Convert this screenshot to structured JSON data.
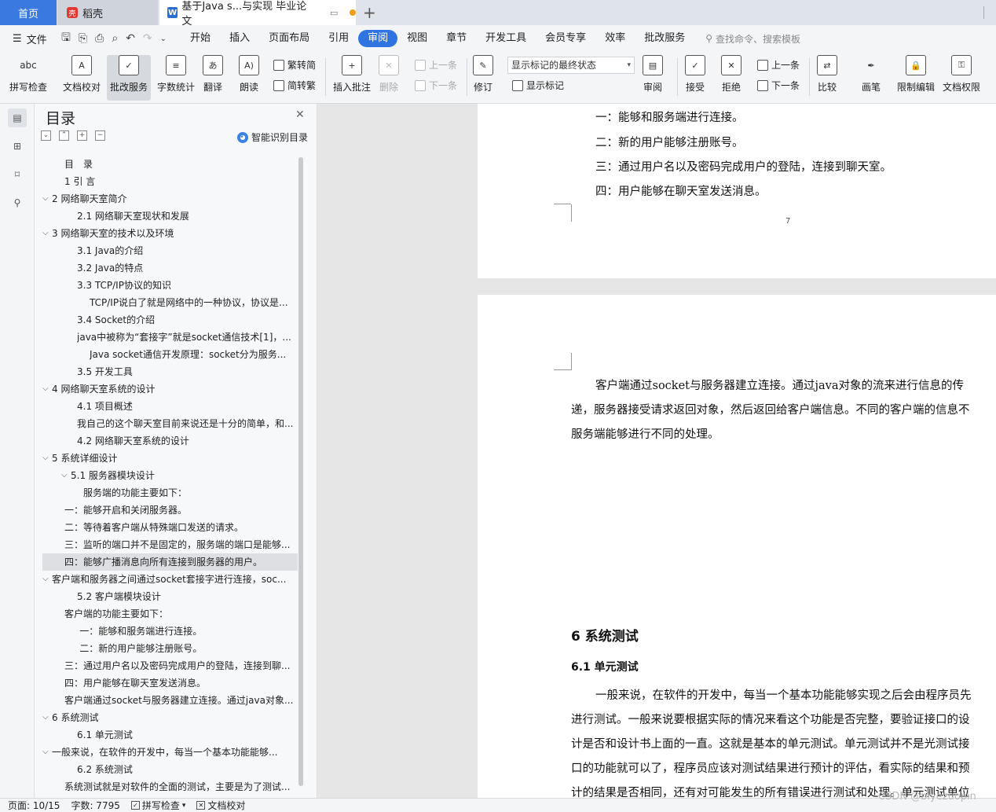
{
  "tabs": {
    "home": "首页",
    "daoke": "稻壳",
    "doc": "基于Java s...与实现 毕业论文"
  },
  "menu": {
    "file": "文件",
    "items": [
      "开始",
      "插入",
      "页面布局",
      "引用",
      "审阅",
      "视图",
      "章节",
      "开发工具",
      "会员专享",
      "效率",
      "批改服务"
    ],
    "active": "审阅",
    "search": "查找命令、搜索模板"
  },
  "ribbon": {
    "spell": "拼写检查",
    "proof": "文档校对",
    "grade": "批改服务",
    "wordcount": "字数统计",
    "translate": "翻译",
    "read": "朗读",
    "trad": "繁转简",
    "simp": "简转繁",
    "insert_comment": "插入批注",
    "delete": "删除",
    "prev": "上一条",
    "next": "下一条",
    "revise": "修订",
    "show_state": "显示标记的最终状态",
    "show_marks": "显示标记",
    "review": "审阅",
    "accept": "接受",
    "reject": "拒绝",
    "prev2": "上一条",
    "next2": "下一条",
    "compare": "比较",
    "pen": "画笔",
    "restrict": "限制编辑",
    "rights": "文档权限"
  },
  "toc": {
    "title": "目录",
    "smart": "智能识别目录",
    "items": [
      {
        "text": "目　录",
        "indent": 1,
        "chev": false
      },
      {
        "text": "1 引 言",
        "indent": 1,
        "chev": false
      },
      {
        "text": "2 网络聊天室简介",
        "indent": 0,
        "chev": true
      },
      {
        "text": "2.1 网络聊天室现状和发展",
        "indent": 2,
        "chev": false
      },
      {
        "text": "3 网络聊天室的技术以及环境",
        "indent": 0,
        "chev": true
      },
      {
        "text": "3.1 Java的介绍",
        "indent": 2,
        "chev": false
      },
      {
        "text": "3.2 Java的特点",
        "indent": 2,
        "chev": false
      },
      {
        "text": "3.3 TCP/IP协议的知识",
        "indent": 2,
        "chev": false
      },
      {
        "text": "TCP/IP说白了就是网络中的一种协议，协议是...",
        "indent": 3,
        "chev": false
      },
      {
        "text": "3.4 Socket的介绍",
        "indent": 2,
        "chev": false
      },
      {
        "text": "java中被称为“套接字”就是socket通信技术[1]，...",
        "indent": 2,
        "chev": false
      },
      {
        "text": "Java socket通信开发原理：socket分为服务...",
        "indent": 3,
        "chev": false
      },
      {
        "text": "3.5 开发工具",
        "indent": 2,
        "chev": false
      },
      {
        "text": "4 网络聊天室系统的设计",
        "indent": 0,
        "chev": true
      },
      {
        "text": "4.1 项目概述",
        "indent": 2,
        "chev": false
      },
      {
        "text": "我自己的这个聊天室目前来说还是十分的简单，和...",
        "indent": 2,
        "chev": false
      },
      {
        "text": "4.2 网络聊天室系统的设计",
        "indent": 2,
        "chev": false
      },
      {
        "text": "5 系统详细设计",
        "indent": 0,
        "chev": true
      },
      {
        "text": "5.1 服务器模块设计",
        "indent": 1.5,
        "chev": true
      },
      {
        "text": "服务端的功能主要如下：",
        "indent": 2.5,
        "chev": false
      },
      {
        "text": "一：能够开启和关闭服务器。",
        "indent": 1,
        "chev": false
      },
      {
        "text": "二：等待着客户端从特殊端口发送的请求。",
        "indent": 1,
        "chev": false
      },
      {
        "text": "三：监听的端口并不是固定的，服务端的端口是能够...",
        "indent": 1,
        "chev": false
      },
      {
        "text": "四：能够广播消息向所有连接到服务器的用户。",
        "indent": 1,
        "chev": false,
        "hl": true
      },
      {
        "text": "客户端和服务器之间通过socket套接字进行连接，soc...",
        "indent": 0,
        "chev": true
      },
      {
        "text": "5.2 客户端模块设计",
        "indent": 2,
        "chev": false
      },
      {
        "text": "客户端的功能主要如下：",
        "indent": 1,
        "chev": false
      },
      {
        "text": "一：能够和服务端进行连接。",
        "indent": 2.2,
        "chev": false
      },
      {
        "text": "二：新的用户能够注册账号。",
        "indent": 2.2,
        "chev": false
      },
      {
        "text": "三：通过用户名以及密码完成用户的登陆，连接到聊...",
        "indent": 1,
        "chev": false
      },
      {
        "text": "四：用户能够在聊天室发送消息。",
        "indent": 1,
        "chev": false
      },
      {
        "text": "客户端通过socket与服务器建立连接。通过java对象...",
        "indent": 1,
        "chev": false
      },
      {
        "text": "6 系统测试",
        "indent": 0,
        "chev": true
      },
      {
        "text": "6.1 单元测试",
        "indent": 2,
        "chev": false
      },
      {
        "text": "一般来说，在软件的开发中，每当一个基本功能能够...",
        "indent": 0,
        "chev": true
      },
      {
        "text": "6.2 系统测试",
        "indent": 2,
        "chev": false
      },
      {
        "text": "系统测试就是对软件的全面的测试，主要是为了测试...",
        "indent": 1,
        "chev": false
      }
    ]
  },
  "page1": {
    "lines": [
      "一：能够和服务端进行连接。",
      "二：新的用户能够注册账号。",
      "三：通过用户名以及密码完成用户的登陆，连接到聊天室。",
      "四：用户能够在聊天室发送消息。"
    ],
    "page_number": "7"
  },
  "page2": {
    "para1": [
      "客户端通过socket与服务器建立连接。通过java对象的流来进行信息的传",
      "递，服务器接受请求返回对象，然后返回给客户端信息。不同的客户端的信息不",
      "服务端能够进行不同的处理。"
    ],
    "h1": "6 系统测试",
    "h2": "6.1 单元测试",
    "para2": [
      "一般来说，在软件的开发中，每当一个基本功能能够实现之后会由程序员先",
      "进行测试。一般来说要根据实际的情况来看这个功能是否完整，要验证接口的设",
      "计是否和设计书上面的一直。这就是基本的单元测试。单元测试并不是光测试接",
      "口的功能就可以了，程序员应该对测试结果进行预计的评估，看实际的结果和预",
      "计的结果是否相同，还有对可能发生的所有错误进行测试和处理。单元测试单位"
    ]
  },
  "status": {
    "page": "页面: 10/15",
    "words": "字数: 7795",
    "spell": "拼写检查",
    "proof": "文档校对"
  },
  "watermark": "CSDN @biyezuopin"
}
